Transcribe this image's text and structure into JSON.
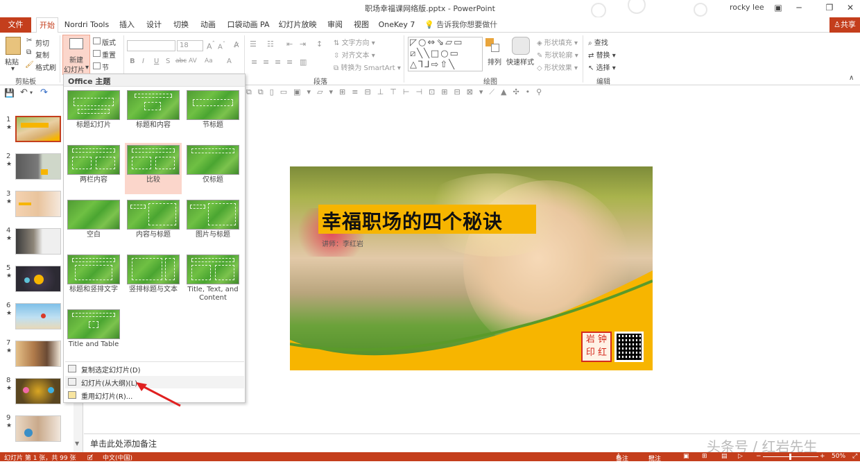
{
  "window": {
    "title": "职场幸福课网络版.pptx - PowerPoint",
    "user": "rocky lee"
  },
  "tabs": [
    "文件",
    "开始",
    "Nordri Tools",
    "插入",
    "设计",
    "切换",
    "动画",
    "口袋动画 PA",
    "幻灯片放映",
    "审阅",
    "视图",
    "OneKey 7"
  ],
  "active_tab": "开始",
  "tell_me": "告诉我你想要做什么",
  "share": "共享",
  "ribbon": {
    "clipboard": {
      "paste": "粘贴",
      "cut": "剪切",
      "copy": "复制",
      "format_painter": "格式刷",
      "label": "剪贴板"
    },
    "slides": {
      "new_slide": "新建",
      "new_slide2": "幻灯片",
      "layout": "版式",
      "reset": "重置",
      "section": "节"
    },
    "font": {
      "size": "18"
    },
    "paragraph": {
      "text_direction": "文字方向",
      "align_text": "对齐文本",
      "smartart": "转换为 SmartArt",
      "label": "段落"
    },
    "drawing": {
      "arrange": "排列",
      "quick_styles": "快速样式",
      "shape_fill": "形状填充",
      "shape_outline": "形状轮廓",
      "shape_effects": "形状效果",
      "label": "绘图"
    },
    "editing": {
      "find": "查找",
      "replace": "替换",
      "select": "选择",
      "label": "编辑"
    }
  },
  "dropdown": {
    "header": "Office 主题",
    "layouts": [
      "标题幻灯片",
      "标题和内容",
      "节标题",
      "两栏内容",
      "比较",
      "仅标题",
      "空白",
      "内容与标题",
      "图片与标题",
      "标题和竖排文字",
      "竖排标题与文本",
      "Title, Text, and Content",
      "Title and Table"
    ],
    "menu": [
      "复制选定幻灯片(D)",
      "幻灯片(从大纲)(L)...",
      "重用幻灯片(R)..."
    ]
  },
  "thumbnails": [
    "1",
    "2",
    "3",
    "4",
    "5",
    "6",
    "7",
    "8",
    "9"
  ],
  "slide": {
    "title": "幸福职场的四个秘诀",
    "subtitle": "讲师：李红岩",
    "seal": "钟红岩印"
  },
  "notes_placeholder": "单击此处添加备注",
  "status": {
    "slide_info": "幻灯片 第 1 张，共 99 张",
    "language": "中文(中国)",
    "notes": "备注",
    "comments": "批注",
    "zoom": "50%"
  },
  "watermark": "头条号 / 红岩先生",
  "colors": {
    "accent": "#c43e1c",
    "slide_yellow": "#f7b500"
  }
}
